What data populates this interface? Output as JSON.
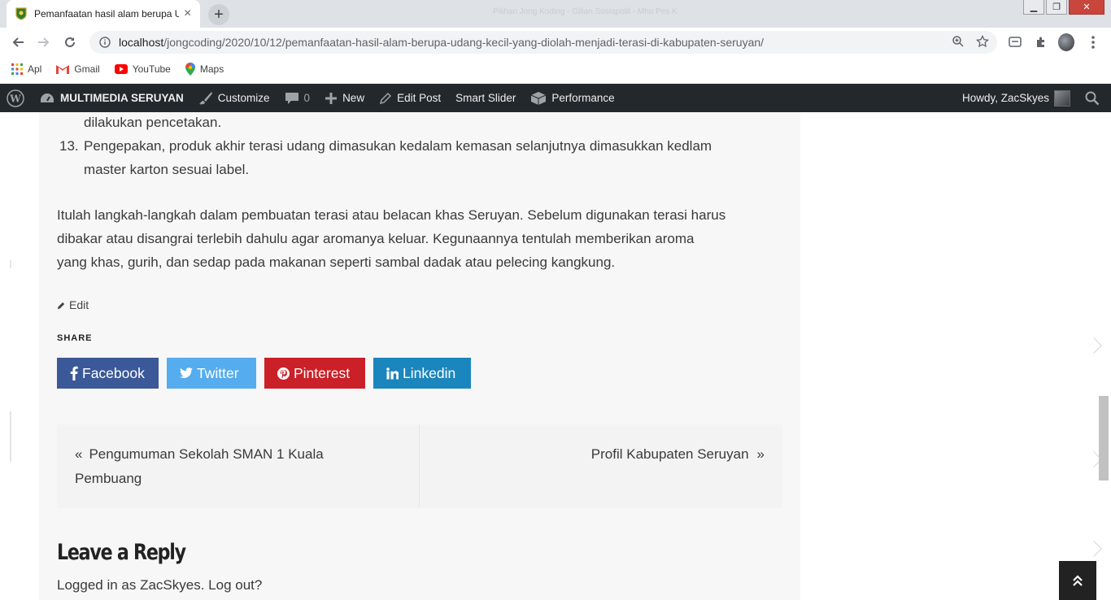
{
  "browser": {
    "tab_title": "Pemanfaatan hasil alam berupa Udang",
    "tab_close": "×",
    "new_tab": "+",
    "window_title": "Pilihan Jong Koding - Gilian Sosiapolit - Mhu Pes K",
    "url_host": "localhost",
    "url_path": "/jongcoding/2020/10/12/pemanfaatan-hasil-alam-berupa-udang-kecil-yang-diolah-menjadi-terasi-di-kabupaten-seruyan/",
    "bookmarks": [
      {
        "label": "Apl"
      },
      {
        "label": "Gmail"
      },
      {
        "label": "YouTube"
      },
      {
        "label": "Maps"
      }
    ]
  },
  "adminbar": {
    "site_name": "MULTIMEDIA SERUYAN",
    "customize": "Customize",
    "comments_count": "0",
    "new": "New",
    "edit_post": "Edit Post",
    "smart_slider": "Smart Slider",
    "performance": "Performance",
    "howdy": "Howdy, ZacSkyes"
  },
  "article": {
    "list_items": [
      {
        "num": "",
        "lines": [
          "dilakukan pencetakan."
        ]
      },
      {
        "num": "13.",
        "lines": [
          "Pengepakan, produk akhir terasi udang dimasukan kedalam kemasan selanjutnya dimasukkan kedlam",
          "master karton sesuai label."
        ]
      }
    ],
    "paragraph_lines": [
      "Itulah langkah-langkah dalam pembuatan terasi atau belacan khas Seruyan. Sebelum digunakan terasi harus",
      "dibakar atau disangrai terlebih dahulu agar aromanya keluar. Kegunaannya tentulah memberikan aroma",
      "yang khas, gurih, dan sedap pada makanan seperti sambal dadak atau pelecing kangkung."
    ],
    "edit_label": "Edit",
    "share_title": "SHARE",
    "share": {
      "facebook": "Facebook",
      "twitter": "Twitter",
      "pinterest": "Pinterest",
      "linkedin": "Linkedin"
    },
    "prev_post": "Pengumuman Sekolah SMAN 1 Kuala Pembuang",
    "next_post": "Profil Kabupaten Seruyan",
    "reply_title": "Leave a Reply",
    "logged_in": "Logged in as ZacSkyes. Log out?"
  },
  "colors": {
    "facebook": "#3b5998",
    "twitter": "#55acee",
    "pinterest": "#cb2027",
    "linkedin": "#1b86bd",
    "adminbar": "#23282d"
  }
}
